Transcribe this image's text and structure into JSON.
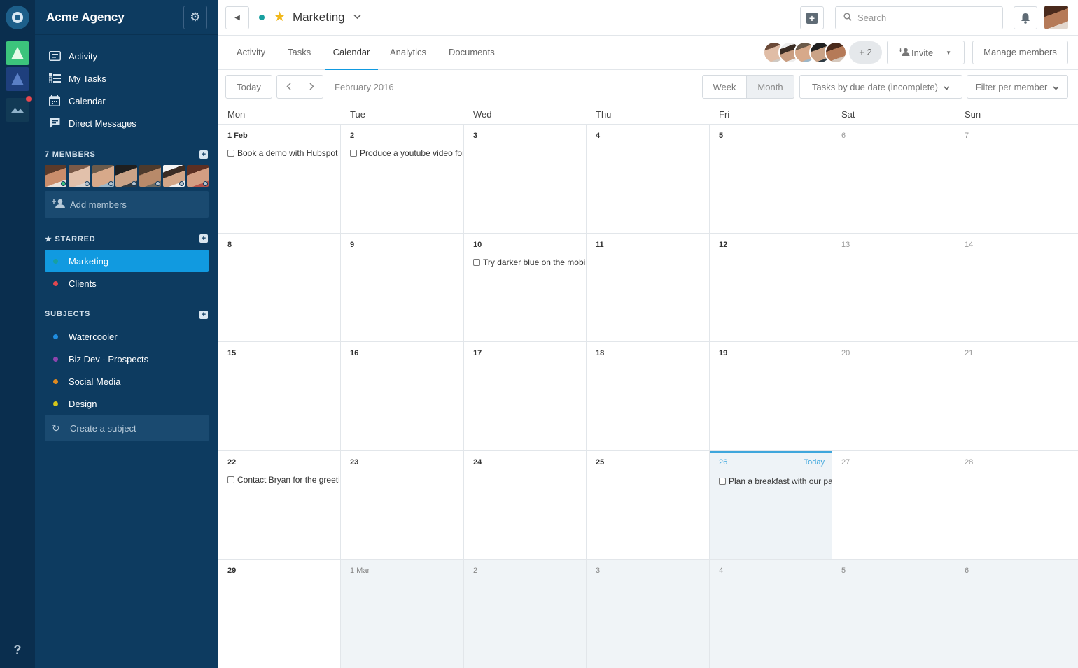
{
  "workspace": {
    "name": "Acme Agency",
    "help_label": "?"
  },
  "sidebar": {
    "nav": [
      {
        "label": "Activity",
        "icon": "activity-icon"
      },
      {
        "label": "My Tasks",
        "icon": "tasks-icon"
      },
      {
        "label": "Calendar",
        "icon": "calendar-icon"
      },
      {
        "label": "Direct Messages",
        "icon": "messages-icon"
      }
    ],
    "members_heading": "7 MEMBERS",
    "add_members_label": "Add members",
    "starred_heading": "STARRED",
    "starred": [
      {
        "label": "Marketing",
        "color": "#18a0a0",
        "active": true
      },
      {
        "label": "Clients",
        "color": "#e0474f",
        "active": false
      }
    ],
    "subjects_heading": "SUBJECTS",
    "subjects": [
      {
        "label": "Watercooler",
        "color": "#1f8de0"
      },
      {
        "label": "Biz Dev - Prospects",
        "color": "#8e44ad"
      },
      {
        "label": "Social Media",
        "color": "#e08a1f"
      },
      {
        "label": "Design",
        "color": "#d4c51a"
      }
    ],
    "create_subject_label": "Create a subject"
  },
  "header": {
    "project_title": "Marketing",
    "project_color": "#18a0a0",
    "search_placeholder": "Search"
  },
  "tabs": [
    {
      "label": "Activity",
      "active": false
    },
    {
      "label": "Tasks",
      "active": false
    },
    {
      "label": "Calendar",
      "active": true
    },
    {
      "label": "Analytics",
      "active": false
    },
    {
      "label": "Documents",
      "active": false
    }
  ],
  "project_members": {
    "more_label": "+ 2",
    "invite_label": "Invite",
    "manage_label": "Manage members"
  },
  "toolbar": {
    "today_label": "Today",
    "period_label": "February 2016",
    "week_label": "Week",
    "month_label": "Month",
    "filter_tasks_label": "Tasks by due date (incomplete)",
    "filter_member_label": "Filter per member"
  },
  "calendar": {
    "weekdays": [
      "Mon",
      "Tue",
      "Wed",
      "Thu",
      "Fri",
      "Sat",
      "Sun"
    ],
    "today_tag": "Today",
    "weeks": [
      [
        {
          "day": "1 Feb",
          "task": "Book a demo with Hubspot"
        },
        {
          "day": "2",
          "task": "Produce a youtube video for the launch"
        },
        {
          "day": "3"
        },
        {
          "day": "4"
        },
        {
          "day": "5"
        },
        {
          "day": "6",
          "weekend": true
        },
        {
          "day": "7",
          "weekend": true
        }
      ],
      [
        {
          "day": "8"
        },
        {
          "day": "9"
        },
        {
          "day": "10",
          "task": "Try darker blue on the mobile app"
        },
        {
          "day": "11"
        },
        {
          "day": "12"
        },
        {
          "day": "13",
          "weekend": true
        },
        {
          "day": "14",
          "weekend": true
        }
      ],
      [
        {
          "day": "15"
        },
        {
          "day": "16"
        },
        {
          "day": "17"
        },
        {
          "day": "18"
        },
        {
          "day": "19"
        },
        {
          "day": "20",
          "weekend": true
        },
        {
          "day": "21",
          "weekend": true
        }
      ],
      [
        {
          "day": "22",
          "task": "Contact Bryan for the greeting cards"
        },
        {
          "day": "23"
        },
        {
          "day": "24"
        },
        {
          "day": "25"
        },
        {
          "day": "26",
          "today": true,
          "task": "Plan a breakfast with our partners"
        },
        {
          "day": "27",
          "weekend": true
        },
        {
          "day": "28",
          "weekend": true
        }
      ],
      [
        {
          "day": "29"
        },
        {
          "day": "1 Mar",
          "out": true
        },
        {
          "day": "2",
          "out": true
        },
        {
          "day": "3",
          "out": true
        },
        {
          "day": "4",
          "out": true
        },
        {
          "day": "5",
          "out": true
        },
        {
          "day": "6",
          "out": true
        }
      ]
    ]
  },
  "colors": {
    "accent": "#119ae0",
    "sidebar_bg": "#0d3b60",
    "rail_bg": "#0a2e4e",
    "star": "#f1b81b",
    "today": "#3ea6dc"
  }
}
